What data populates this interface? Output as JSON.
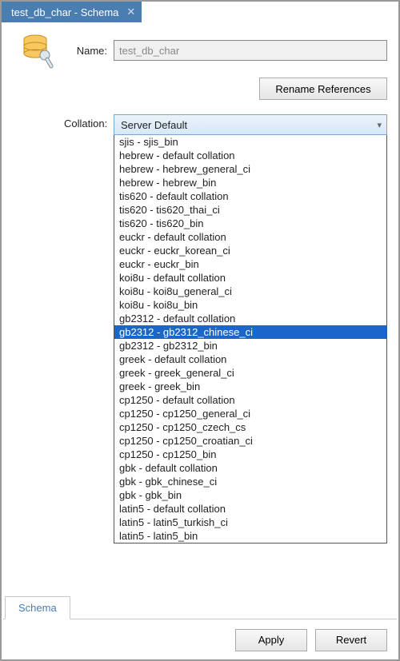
{
  "tab": {
    "title": "test_db_char - Schema"
  },
  "form": {
    "name_label": "Name:",
    "name_value": "test_db_char",
    "rename_button": "Rename References",
    "collation_label": "Collation:"
  },
  "collation": {
    "selected_display": "Server Default",
    "highlighted_index": 14,
    "options": [
      "sjis - sjis_bin",
      "hebrew - default collation",
      "hebrew - hebrew_general_ci",
      "hebrew - hebrew_bin",
      "tis620 - default collation",
      "tis620 - tis620_thai_ci",
      "tis620 - tis620_bin",
      "euckr - default collation",
      "euckr - euckr_korean_ci",
      "euckr - euckr_bin",
      "koi8u - default collation",
      "koi8u - koi8u_general_ci",
      "koi8u - koi8u_bin",
      "gb2312 - default collation",
      "gb2312 - gb2312_chinese_ci",
      "gb2312 - gb2312_bin",
      "greek - default collation",
      "greek - greek_general_ci",
      "greek - greek_bin",
      "cp1250 - default collation",
      "cp1250 - cp1250_general_ci",
      "cp1250 - cp1250_czech_cs",
      "cp1250 - cp1250_croatian_ci",
      "cp1250 - cp1250_bin",
      "gbk - default collation",
      "gbk - gbk_chinese_ci",
      "gbk - gbk_bin",
      "latin5 - default collation",
      "latin5 - latin5_turkish_ci",
      "latin5 - latin5_bin"
    ]
  },
  "bottom": {
    "tab_schema": "Schema"
  },
  "footer": {
    "apply": "Apply",
    "revert": "Revert"
  }
}
